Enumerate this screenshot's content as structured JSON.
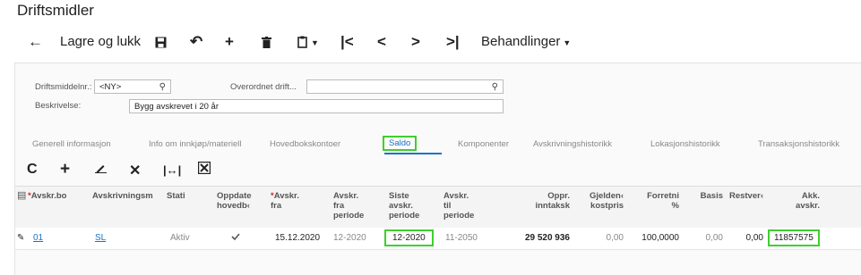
{
  "page_title": "Driftsmidler",
  "toolbar": {
    "back_icon": "arrow-left-icon",
    "save_close_label": "Lagre og lukk",
    "save_icon": "save-icon",
    "undo_icon": "undo-icon",
    "add_icon": "plus-icon",
    "delete_icon": "trash-icon",
    "copy_icon": "copy-paste-icon",
    "first_icon": "first-record-icon",
    "prev_icon": "previous-icon",
    "next_icon": "next-icon",
    "last_icon": "last-record-icon",
    "actions_label": "Behandlinger"
  },
  "form": {
    "asset_no_label": "Driftsmiddelnr.:",
    "asset_no_value": "<NY>",
    "parent_label": "Overordnet drift...",
    "parent_value": "",
    "description_label": "Beskrivelse:",
    "description_value": "Bygg avskrevet i 20 år"
  },
  "tabs": [
    "Generell informasjon",
    "Info om innkjøp/materiell",
    "Hovedbokskontoer",
    "Saldo",
    "Komponenter",
    "Avskrivningshistorikk",
    "Lokasjonshistorikk",
    "Transaksjonshistorikk"
  ],
  "active_tab": "Saldo",
  "grid_toolbar": {
    "refresh_icon": "refresh-icon",
    "add_icon": "plus-icon",
    "edit_icon": "pencil-icon",
    "delete_icon": "close-icon",
    "fit_icon": "fit-width-icon",
    "export_icon": "excel-export-icon"
  },
  "columns": {
    "c1": "Avskr.bo",
    "c2": "Avskrivningsm",
    "c3": "Stati",
    "c4a": "Oppdate",
    "c4b": "hovedb‹",
    "c5a": "Avskr.",
    "c5b": "fra",
    "c6a": "Avskr.",
    "c6b": "fra",
    "c6c": "periode",
    "c7a": "Siste",
    "c7b": "avskr.",
    "c7c": "periode",
    "c8a": "Avskr.",
    "c8b": "til",
    "c8c": "periode",
    "c9a": "Oppr.",
    "c9b": "inntaksk",
    "c10a": "Gjelden‹",
    "c10b": "kostpris",
    "c11a": "Forretni",
    "c11b": "%",
    "c12": "Basis",
    "c13": "Restver‹",
    "c14a": "Akk.",
    "c14b": "avskr."
  },
  "row": {
    "book": "01",
    "method": "SL",
    "status": "Aktiv",
    "updated": true,
    "from_date": "15.12.2020",
    "from_period": "12-2020",
    "last_period": "12-2020",
    "to_period": "11-2050",
    "orig_cost": "29 520 936",
    "current_cost": "0,00",
    "business_pct": "100,0000",
    "basis": "0,00",
    "residual": "0,00",
    "accum_depr": "11857575"
  }
}
